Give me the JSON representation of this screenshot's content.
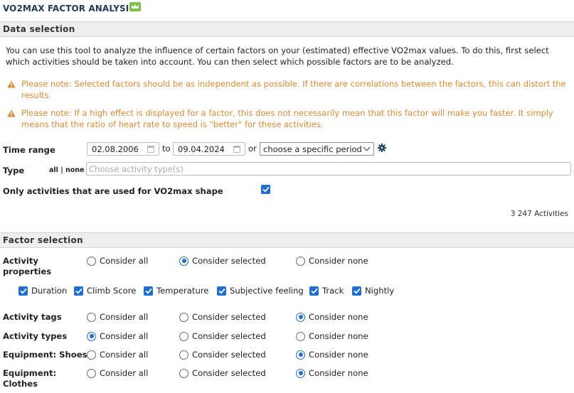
{
  "header": {
    "title": "VO2MAX FACTOR ANALYSIS",
    "premium_icon": "crown-icon",
    "premium_color": "#7cc043"
  },
  "data_selection": {
    "heading": "Data selection",
    "intro": "You can use this tool to analyze the influence of certain factors on your (estimated) effective VO2max values. To do this, first select which activities should be taken into account. You can then select which possible factors are to be analyzed.",
    "warnings": [
      "Please note: Selected factors should be as independent as possible. If there are correlations between the factors, this can distort the results.",
      "Please note: If a high effect is displayed for a factor, this does not necessarily mean that this factor will make you faster. It simply means that the ratio of heart rate to speed is \"better\" for these activities."
    ],
    "warning_color": "#e0892e",
    "time_range": {
      "label": "Time range",
      "from": "02.08.2006",
      "to_label": "to",
      "to": "09.04.2024",
      "or_label": "or",
      "period_select": "choose a specific period"
    },
    "type": {
      "label": "Type",
      "all_none": "all | none",
      "placeholder": "Choose activity type(s)"
    },
    "vo2max_only": {
      "label": "Only activities that are used for VO2max shape",
      "checked": true
    },
    "activity_count": "3 247 Activities"
  },
  "factor_selection": {
    "heading": "Factor selection",
    "options": {
      "all": "Consider all",
      "selected": "Consider selected",
      "none": "Consider none"
    },
    "activity_properties": {
      "label": "Activity properties",
      "choice": "selected",
      "checkboxes": [
        {
          "label": "Duration",
          "checked": true
        },
        {
          "label": "Climb Score",
          "checked": true
        },
        {
          "label": "Temperature",
          "checked": true
        },
        {
          "label": "Subjective feeling",
          "checked": true
        },
        {
          "label": "Track",
          "checked": true
        },
        {
          "label": "Nightly",
          "checked": true
        }
      ]
    },
    "rows": [
      {
        "label": "Activity tags",
        "choice": "none"
      },
      {
        "label": "Activity types",
        "choice": "all"
      },
      {
        "label": "Equipment: Shoes",
        "choice": "none"
      },
      {
        "label": "Equipment: Clothes",
        "choice": "none"
      }
    ]
  },
  "accent_color": "#1f6fd1"
}
